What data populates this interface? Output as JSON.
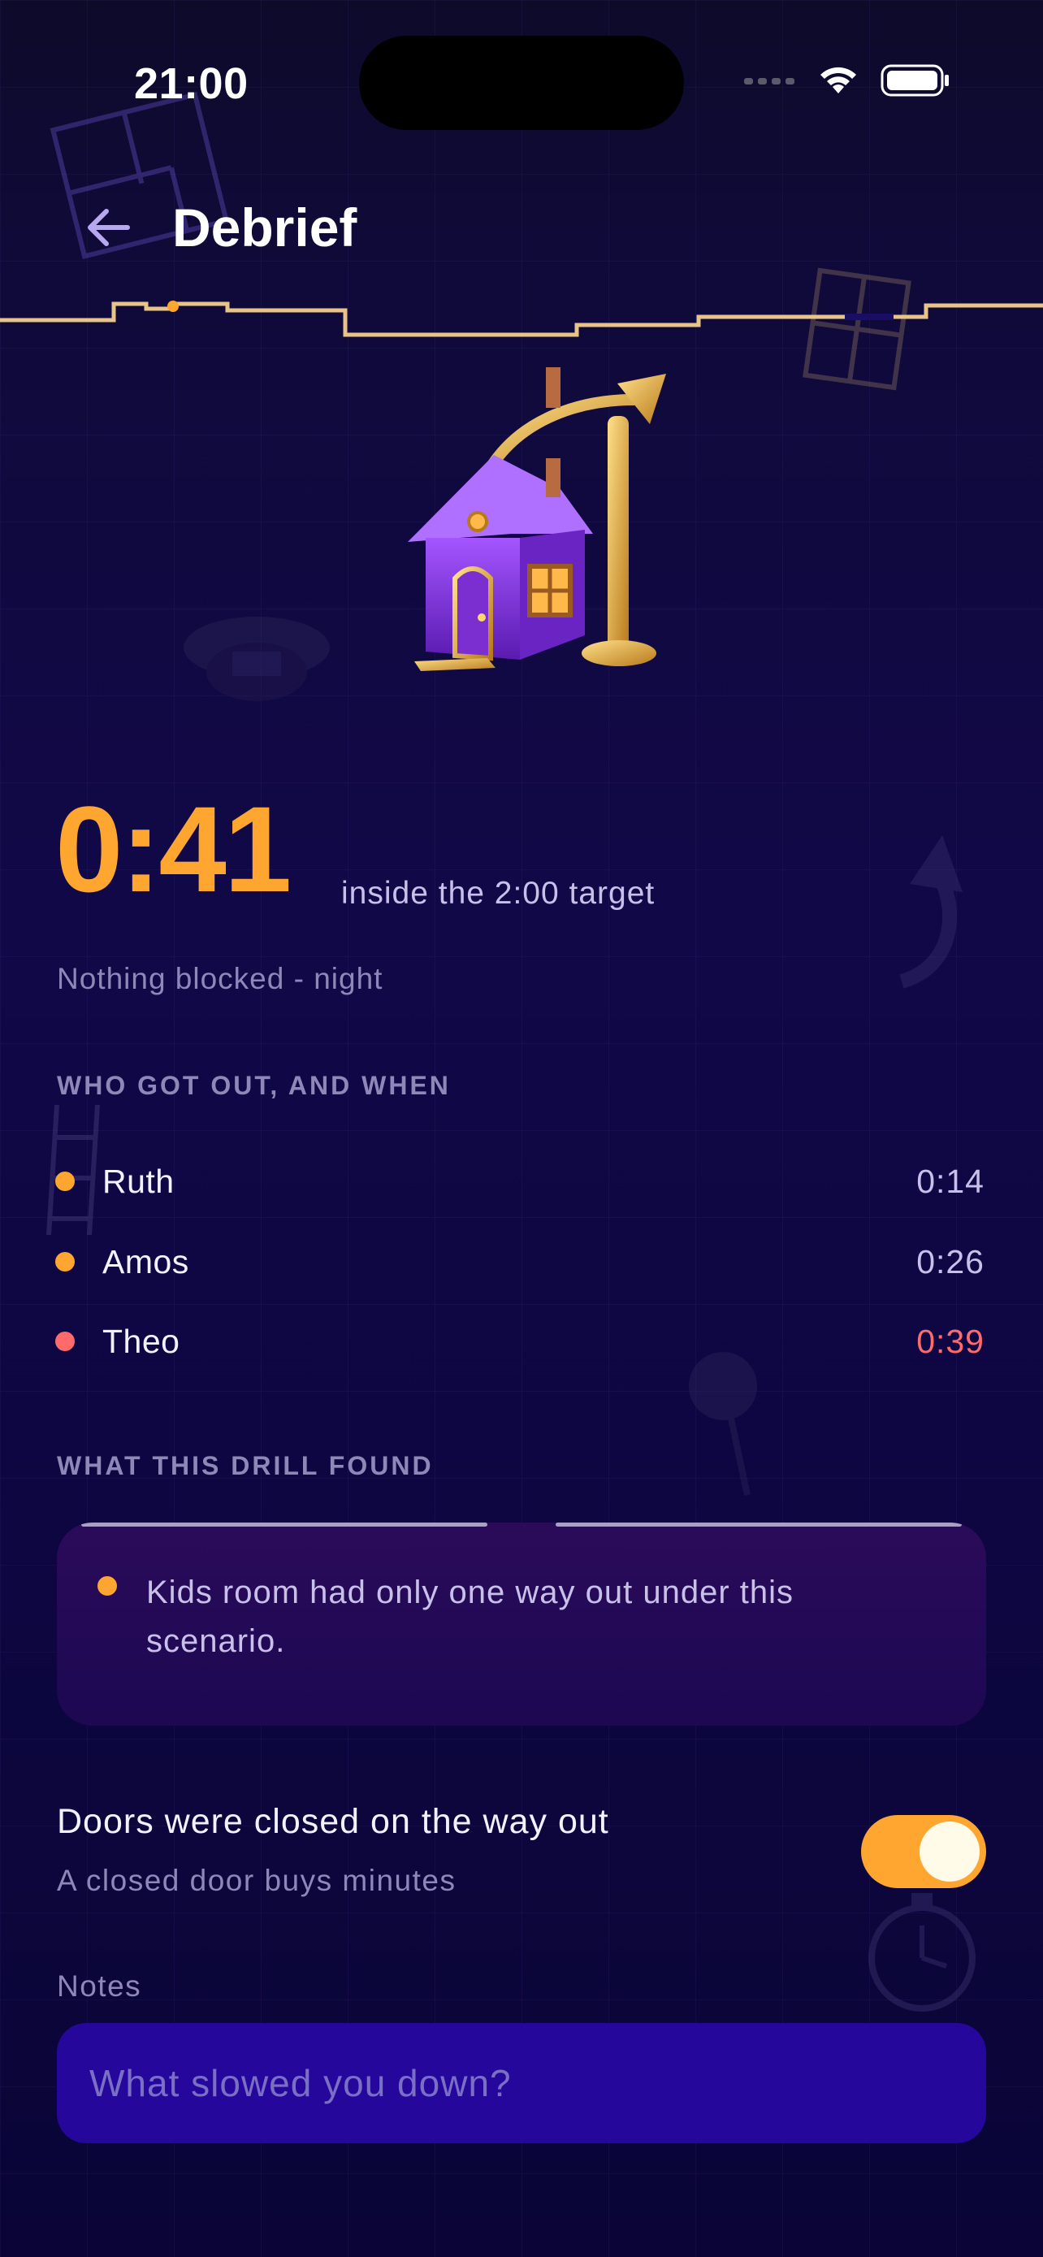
{
  "status_bar": {
    "time": "21:00",
    "icons": [
      "signal-icon",
      "wifi-icon",
      "battery-icon"
    ]
  },
  "header": {
    "back_icon": "arrow-left-icon",
    "title": "Debrief"
  },
  "result": {
    "time": "0:41",
    "target_text": "inside the 2:00 target",
    "scenario": "Nothing blocked - night"
  },
  "escape": {
    "section_label": "WHO GOT OUT, AND WHEN",
    "people": [
      {
        "name": "Ruth",
        "time": "0:14",
        "status_color": "#ffa631"
      },
      {
        "name": "Amos",
        "time": "0:26",
        "status_color": "#ffa631"
      },
      {
        "name": "Theo",
        "time": "0:39",
        "status_color": "#ff6b6b"
      }
    ]
  },
  "findings": {
    "section_label": "WHAT THIS DRILL FOUND",
    "items": [
      {
        "text": "Kids room had only one way out under this scenario."
      }
    ]
  },
  "doors_toggle": {
    "title": "Doors were closed on the way out",
    "subtitle": "A closed door buys minutes",
    "value": true
  },
  "notes": {
    "label": "Notes",
    "placeholder": "What slowed you down?",
    "value": ""
  },
  "colors": {
    "accent": "#ffa631",
    "warning": "#ff6b6b",
    "background": "#110848",
    "input_bg": "#26079b"
  }
}
